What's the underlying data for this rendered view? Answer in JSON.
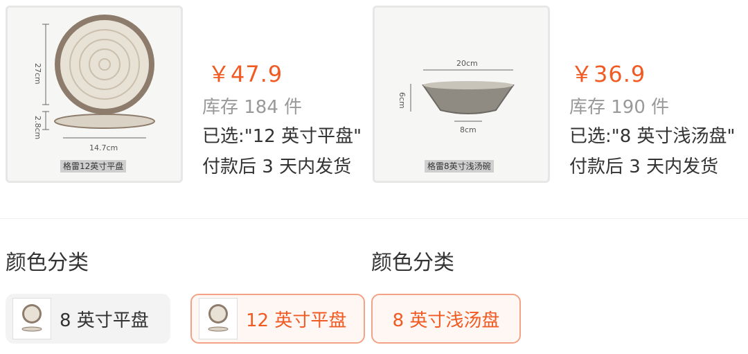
{
  "left": {
    "image": {
      "dims": [
        "27cm",
        "2.8cm",
        "14.7cm"
      ],
      "caption": "格雷12英寸平盘"
    },
    "price": "￥47.9",
    "stock": "库存 184 件",
    "selected": "已选:\"12 英寸平盘\"",
    "shipping": "付款后 3 天内发货",
    "section_title": "颜色分类",
    "options": [
      {
        "label": "8 英寸平盘",
        "state": "unselected"
      },
      {
        "label": "12 英寸平盘",
        "state": "selected"
      }
    ]
  },
  "right": {
    "image": {
      "dims": [
        "20cm",
        "6cm",
        "8cm"
      ],
      "caption": "格雷8英寸浅汤碗"
    },
    "price": "￥36.9",
    "stock": "库存 190 件",
    "selected": "已选:\"8 英寸浅汤盘\"",
    "shipping": "付款后 3 天内发货",
    "section_title": "颜色分类",
    "options": [
      {
        "label": "8 英寸浅汤盘",
        "state": "selected"
      }
    ]
  },
  "colors": {
    "accent": "#f15a22",
    "option_border": "#f4a285"
  }
}
